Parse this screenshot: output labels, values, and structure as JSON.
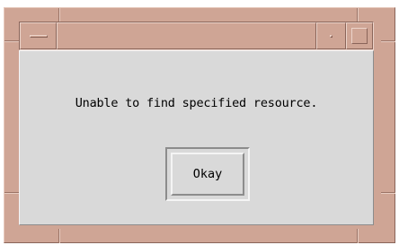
{
  "window": {
    "title": "",
    "frame_color": "#cfa595",
    "client_color": "#d9d9d9"
  },
  "titlebar": {
    "menu_button_icon": "window-menu-icon",
    "minimize_button_icon": "minimize-icon",
    "maximize_button_icon": "maximize-icon"
  },
  "dialog": {
    "message": "Unable to find specified resource.",
    "ok_label": "Okay"
  }
}
